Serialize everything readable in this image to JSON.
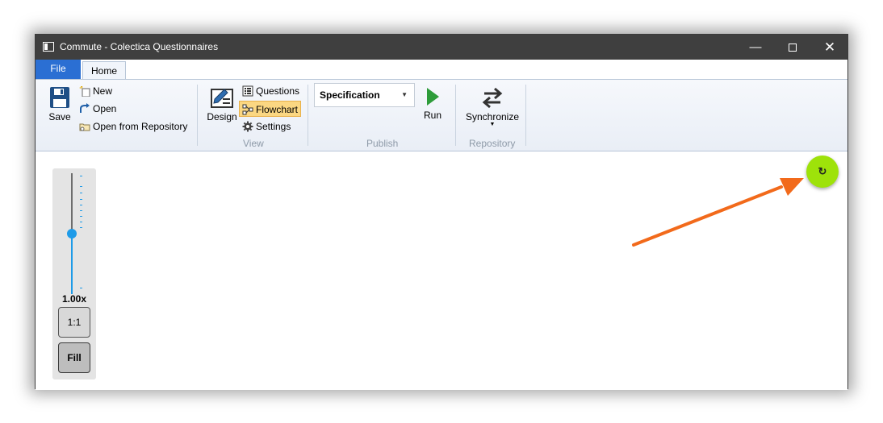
{
  "window": {
    "title": "Commute - Colectica Questionnaires",
    "controls": {
      "minimize": "—",
      "close": "✕"
    }
  },
  "tabs": [
    {
      "label": "File"
    },
    {
      "label": "Home"
    }
  ],
  "ribbon": {
    "file_group": {
      "save_label": "Save",
      "new_label": "New",
      "open_label": "Open",
      "open_repo_label": "Open from Repository"
    },
    "view_group": {
      "label": "View",
      "design_label": "Design",
      "questions_label": "Questions",
      "flowchart_label": "Flowchart",
      "settings_label": "Settings"
    },
    "publish_group": {
      "label": "Publish",
      "format_selected": "Specification",
      "run_label": "Run"
    },
    "repository_group": {
      "label": "Repository",
      "synchronize_label": "Synchronize"
    }
  },
  "zoom": {
    "readout": "1.00x",
    "level_fraction": 0.5,
    "one_to_one_label": "1:1",
    "fill_label": "Fill"
  },
  "refresh_icon": "↻",
  "colors": {
    "file_tab": "#2b6fd3",
    "accent_slider": "#1e9be8",
    "refresh_button": "#9ee20a",
    "annotation_arrow": "#f26a1b",
    "flowchart_active": "#fbd782"
  },
  "icons": {
    "save": "floppy-disk-icon",
    "new": "new-document-icon",
    "open": "open-arrow-icon",
    "open_repo": "repository-folder-icon",
    "design": "design-icon",
    "questions": "questions-list-icon",
    "flowchart": "flowchart-icon",
    "settings": "gear-icon",
    "run": "play-icon",
    "synchronize": "sync-arrows-icon",
    "refresh": "refresh-icon"
  }
}
